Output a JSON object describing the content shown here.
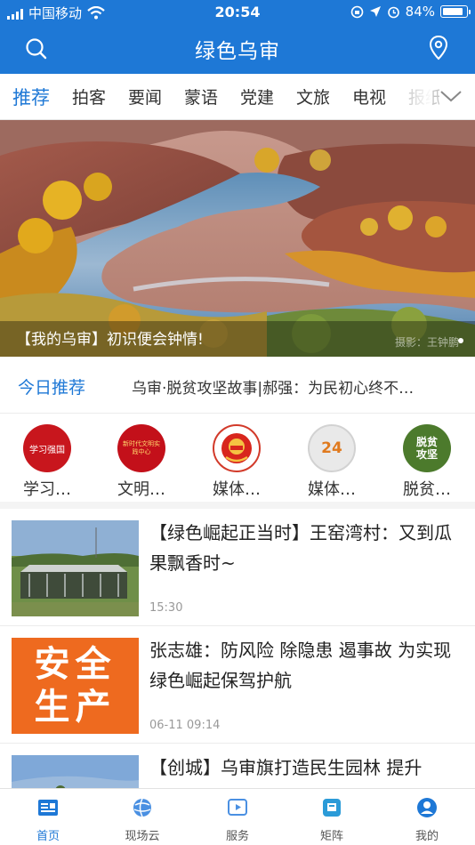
{
  "status_bar": {
    "carrier": "中国移动",
    "time": "20:54",
    "battery": "84%",
    "battery_level": 0.84
  },
  "header": {
    "title": "绿色乌审",
    "search_icon": "search-icon",
    "location_icon": "location-pin-icon"
  },
  "tabs": [
    {
      "label": "推荐",
      "active": true
    },
    {
      "label": "拍客"
    },
    {
      "label": "要闻"
    },
    {
      "label": "蒙语"
    },
    {
      "label": "党建"
    },
    {
      "label": "文旅"
    },
    {
      "label": "电视"
    },
    {
      "label": "报纸"
    }
  ],
  "banner": {
    "caption": "【我的乌审】初识便会钟情!",
    "credit": "摄影：王钟鹏"
  },
  "today": {
    "label": "今日推荐",
    "headline": "乌审·脱贫攻坚故事|郝强：为民初心终不…"
  },
  "shortcuts": [
    {
      "label": "学习…",
      "logo_text": "学习强国",
      "icon": "xuexi-qiangguo-logo-icon"
    },
    {
      "label": "文明…",
      "logo_text": "新时代文明实践中心",
      "icon": "civilization-center-logo-icon"
    },
    {
      "label": "媒体…",
      "icon": "national-emblem-icon"
    },
    {
      "label": "媒体…",
      "logo_text": "24",
      "icon": "24-hour-service-icon"
    },
    {
      "label": "脱贫…",
      "logo_text": "脱贫攻坚",
      "icon": "poverty-alleviation-icon"
    }
  ],
  "news": [
    {
      "title": "【绿色崛起正当时】王窑湾村：又到瓜果飘香时~",
      "time": "15:30"
    },
    {
      "title": "张志雄：防风险 除隐患 遏事故 为实现绿色崛起保驾护航",
      "time": "06-11 09:14",
      "thumb_text": [
        "安全",
        "生产"
      ]
    },
    {
      "title": "【创城】乌审旗打造民生园林 提升",
      "time": ""
    }
  ],
  "bottom_nav": [
    {
      "label": "首页",
      "icon": "home-news-icon",
      "active": true
    },
    {
      "label": "现场云",
      "icon": "globe-icon"
    },
    {
      "label": "服务",
      "icon": "play-icon"
    },
    {
      "label": "矩阵",
      "icon": "matrix-icon"
    },
    {
      "label": "我的",
      "icon": "user-icon"
    }
  ],
  "colors": {
    "brand": "#1e78d6",
    "safety_orange": "#ee6a1f"
  }
}
